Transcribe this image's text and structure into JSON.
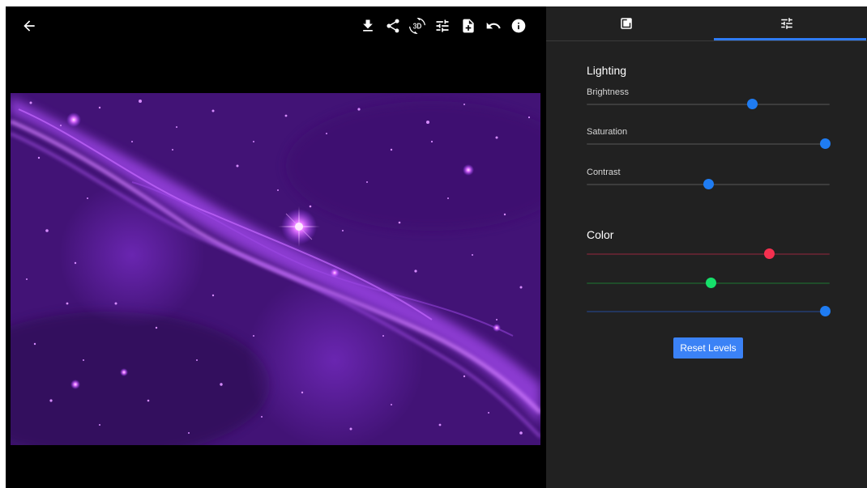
{
  "toolbar": {
    "back": "arrow-back-icon",
    "actions": [
      "download-icon",
      "share-icon",
      "crop-rotate-icon",
      "tune-icon",
      "add-file-icon",
      "undo-icon",
      "info-icon"
    ]
  },
  "image": {
    "subject": "purple nebula"
  },
  "tabs": {
    "items": [
      {
        "icon": "add-photo-icon",
        "selected": false
      },
      {
        "icon": "tune-icon",
        "selected": true
      }
    ],
    "indicator_color": "#2f7cf6"
  },
  "lighting": {
    "title": "Lighting",
    "sliders": [
      {
        "label": "Brightness",
        "value": 0.68
      },
      {
        "label": "Saturation",
        "value": 0.98
      },
      {
        "label": "Contrast",
        "value": 0.5
      }
    ]
  },
  "color": {
    "title": "Color",
    "channels": [
      {
        "channel": "red",
        "value": 0.75,
        "track_color": "#5c2430",
        "thumb_color": "#f5304f"
      },
      {
        "channel": "green",
        "value": 0.51,
        "track_color": "#1f4d2a",
        "thumb_color": "#16e06a"
      },
      {
        "channel": "blue",
        "value": 0.98,
        "track_color": "#23365e",
        "thumb_color": "#1f7cf2"
      }
    ]
  },
  "reset_label": "Reset Levels",
  "colors": {
    "accent": "#1f7cf2",
    "track": "#3d3d3d",
    "panel": "#212121"
  }
}
